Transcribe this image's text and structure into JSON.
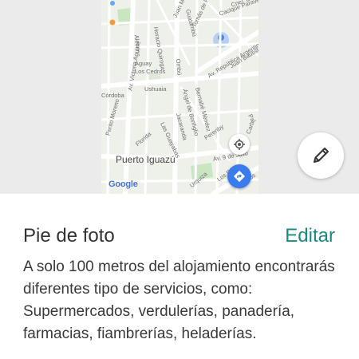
{
  "map": {
    "city_label": "Puerto Iguazú",
    "google_label": "Google",
    "streets": [
      "Cnel. Bom",
      "Cacique Paravera",
      "Juan Ma",
      "Tomás de Rocamora",
      "Alecrin",
      "Horacio Quiroga",
      "Guatambú",
      "Av. República Argentina",
      "Juan Bautist",
      "Aguay",
      "Los Cedros",
      "Ombú",
      "Ushuaia",
      "Córdoba",
      "Av. Victoria Aguirre",
      "Perito Moreno",
      "Bernabé Méndez",
      "Ángel de Bonfiglio",
      "Jacaranda",
      "Las Guayabas",
      "Peteriby",
      "Florida",
      "Pal",
      "Carb",
      "Av. 9 de Julio",
      "Urquiza",
      "Los Ríos",
      "Ríos"
    ]
  },
  "caption": {
    "title": "Pie de foto",
    "edit_label": "Editar",
    "text": "A solo 100 metros del alojamiento encontrarás diferentes tipo de servicios, como: Supermercados, verdulerías, panadería, farmacias, fiambrerías, heladerías."
  },
  "colors": {
    "accent": "#1a8a80",
    "directions_button": "#3b7bf0",
    "map_background": "#eef0ea",
    "park_green": "#c8e6c0"
  },
  "icons": {
    "edit": "pencil-icon",
    "locate": "my-location-icon",
    "directions": "directions-icon"
  }
}
